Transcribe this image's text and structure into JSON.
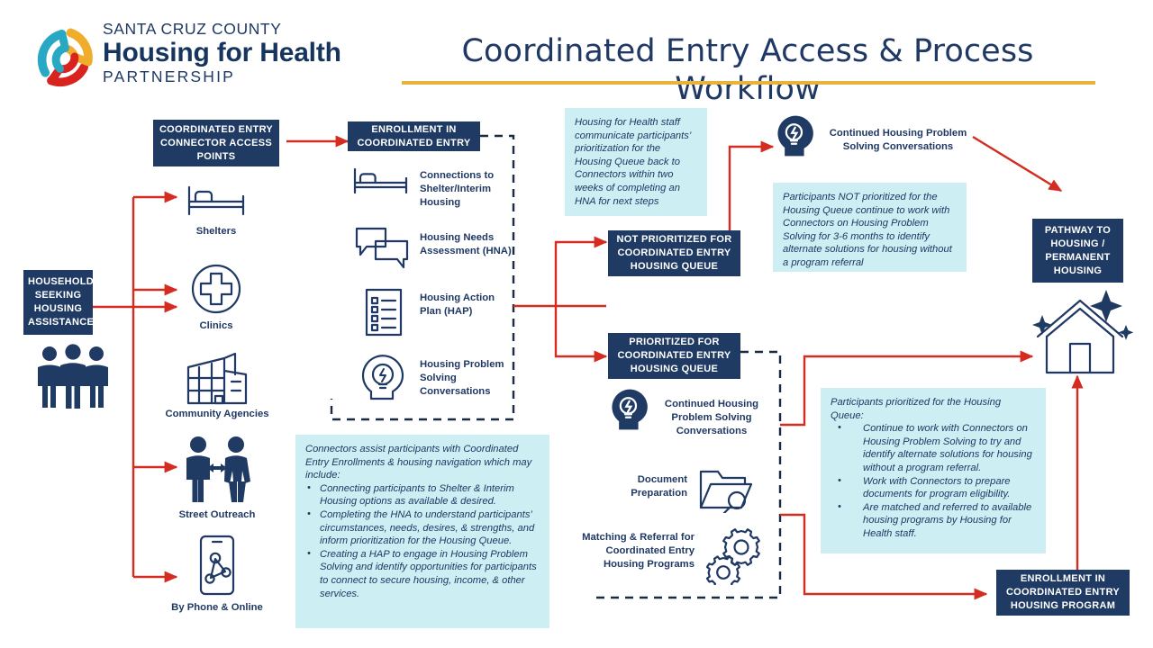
{
  "header": {
    "logo": {
      "line1": "SANTA CRUZ COUNTY",
      "line2": "Housing for Health",
      "line3": "PARTNERSHIP",
      "colors": {
        "teal": "#29a8c4",
        "amber": "#f0ad2b",
        "red": "#d8231f",
        "navy": "#16355e"
      }
    },
    "title": "Coordinated Entry Access & Process Workflow",
    "rule_color": "#e8b33a"
  },
  "theme": {
    "navy": "#1f3a63",
    "callout_bg": "#cdeef3",
    "arrow_red": "#d42c20",
    "text_navy": "#1f3864"
  },
  "entry": {
    "households_box": "HOUSEHOLDS SEEKING HOUSING ASSISTANCE",
    "households_icon": "three-people-icon",
    "access_points": [
      {
        "label": "Shelters",
        "icon": "bed-icon"
      },
      {
        "label": "Clinics",
        "icon": "medical-cross-circle-icon"
      },
      {
        "label": "Community Agencies",
        "icon": "building-icon"
      },
      {
        "label": "Street Outreach",
        "icon": "two-people-arrow-icon"
      },
      {
        "label": "By Phone & Online",
        "icon": "smartphone-network-icon"
      }
    ]
  },
  "connector_box": {
    "title": "COORDINATED ENTRY CONNECTOR ACCESS POINTS"
  },
  "enrollment": {
    "title": "ENROLLMENT IN COORDINATED ENTRY",
    "services": [
      {
        "label": "Connections to Shelter/Interim Housing",
        "icon": "bed-icon"
      },
      {
        "label": "Housing Needs Assessment (HNA)",
        "icon": "speech-bubbles-icon"
      },
      {
        "label": "Housing Action Plan (HAP)",
        "icon": "checklist-document-icon"
      },
      {
        "label": "Housing Problem Solving Conversations",
        "icon": "head-lightbulb-icon"
      }
    ]
  },
  "callouts": {
    "staff_communication": "Housing for Health staff communicate participants’ prioritization for the Housing Queue back to Connectors within two weeks of completing an HNA for next steps",
    "connectors_assist": {
      "intro": "Connectors assist participants with Coordinated Entry Enrollments & housing navigation which may include:",
      "bullets": [
        "Connecting participants to Shelter & Interim Housing options as available & desired.",
        "Completing the HNA to understand participants’ circumstances, needs, desires, & strengths, and inform prioritization for the Housing Queue.",
        "Creating a HAP to engage in Housing Problem Solving and identify opportunities for participants to connect to secure housing, income, & other services."
      ]
    },
    "not_prioritized_note": "Participants NOT prioritized for the Housing Queue continue to work with Connectors on Housing Problem Solving for 3-6 months to identify alternate solutions for housing without a program referral",
    "prioritized_note": {
      "intro": "Participants prioritized for the Housing Queue:",
      "bullets": [
        "Continue to work with Connectors on Housing Problem Solving to try and identify alternate solutions for housing without a program referral.",
        "Work with Connectors to prepare documents for program eligibility.",
        "Are matched and referred to available housing programs by Housing for Health staff."
      ]
    }
  },
  "branches": {
    "not_prioritized": {
      "title": "NOT PRIORITIZED FOR COORDINATED ENTRY HOUSING QUEUE",
      "followup_label": "Continued Housing Problem Solving Conversations",
      "followup_icon": "head-lightbulb-icon"
    },
    "prioritized": {
      "title": "PRIORITIZED FOR COORDINATED ENTRY HOUSING QUEUE",
      "steps": [
        {
          "label": "Continued Housing Problem Solving Conversations",
          "icon": "head-lightbulb-icon"
        },
        {
          "label": "Document Preparation",
          "icon": "folder-magnifier-icon"
        },
        {
          "label": "Matching & Referral for Coordinated Entry Housing Programs",
          "icon": "gears-icon"
        }
      ]
    }
  },
  "outcomes": {
    "pathway_box": "PATHWAY TO HOUSING / PERMANENT HOUSING",
    "pathway_icon": "house-sparkle-icon",
    "program_enrollment_box": "ENROLLMENT IN COORDINATED ENTRY HOUSING PROGRAM"
  }
}
